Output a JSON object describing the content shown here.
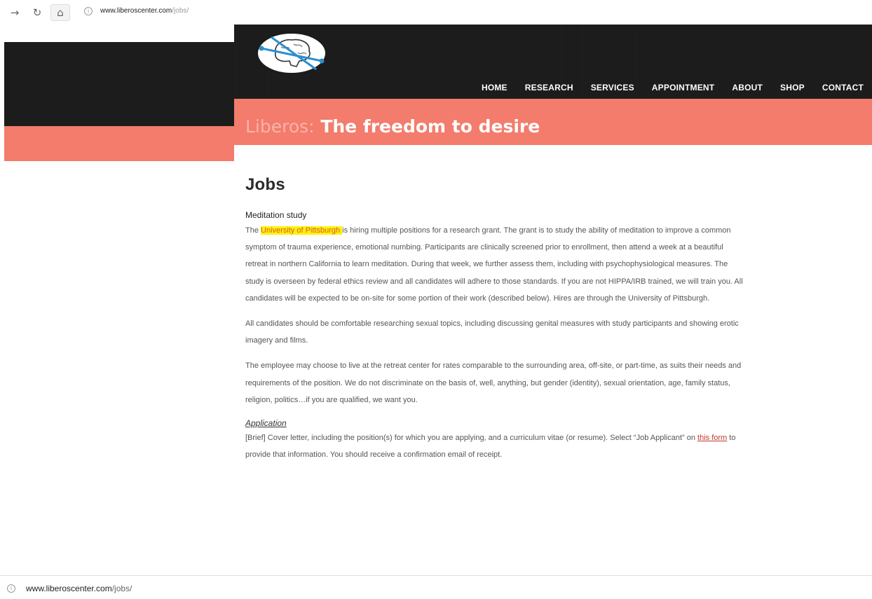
{
  "browser": {
    "url_host": "www.liberoscenter.com",
    "url_path": "/jobs/",
    "back_glyph": "→",
    "reload_glyph": "↻",
    "home_glyph": "⌂",
    "info_glyph": "i"
  },
  "nav": {
    "items": [
      "HOME",
      "RESEARCH",
      "SERVICES",
      "APPOINTMENT",
      "ABOUT",
      "SHOP",
      "CONTACT"
    ]
  },
  "banner": {
    "brand": "Liberos:",
    "tagline": "The freedom to desire"
  },
  "page": {
    "title": "Jobs",
    "section": "Meditation study",
    "p1_prefix": "The ",
    "p1_highlight": "University of Pittsburgh ",
    "p1_rest": "is hiring multiple positions for a research grant. The grant is to study the ability of meditation to improve a common symptom of trauma experience, emotional numbing. Participants are clinically screened prior to enrollment, then attend a week at a beautiful retreat in northern California to learn meditation. During that week, we further assess them, including with psychophysiological measures. The study is overseen by federal ethics review and all candidates will adhere to those standards. If you are not HIPPA/IRB trained, we will train you. All candidates will be expected to be on-site for some portion of their work (described below). Hires are through the University of Pittsburgh.",
    "p2": "All candidates should be comfortable researching sexual topics, including discussing genital measures with study participants and showing erotic imagery and films.",
    "p3": "The employee may choose to live at the retreat center for rates comparable to the surrounding area, off-site, or part-time, as suits their needs and requirements of the position. We do not discriminate on the basis of, well, anything, but gender (identity), sexual orientation, age, family status, religion, politics…if you are qualified, we want you.",
    "application_head": "Application",
    "app_prefix": "[Brief] Cover letter, including the position(s) for which you are applying, and a curriculum vitae (or resume). Select “Job Applicant” on ",
    "app_link": "this form",
    "app_suffix": " to provide that information. You should receive a confirmation email of receipt."
  },
  "status": {
    "url_host": "www.liberoscenter.com",
    "url_path": "/jobs/"
  },
  "colors": {
    "header_dark": "#1b1b1b",
    "accent_salmon": "#f37c6c",
    "highlight": "#fff200",
    "link": "#c0392b"
  }
}
